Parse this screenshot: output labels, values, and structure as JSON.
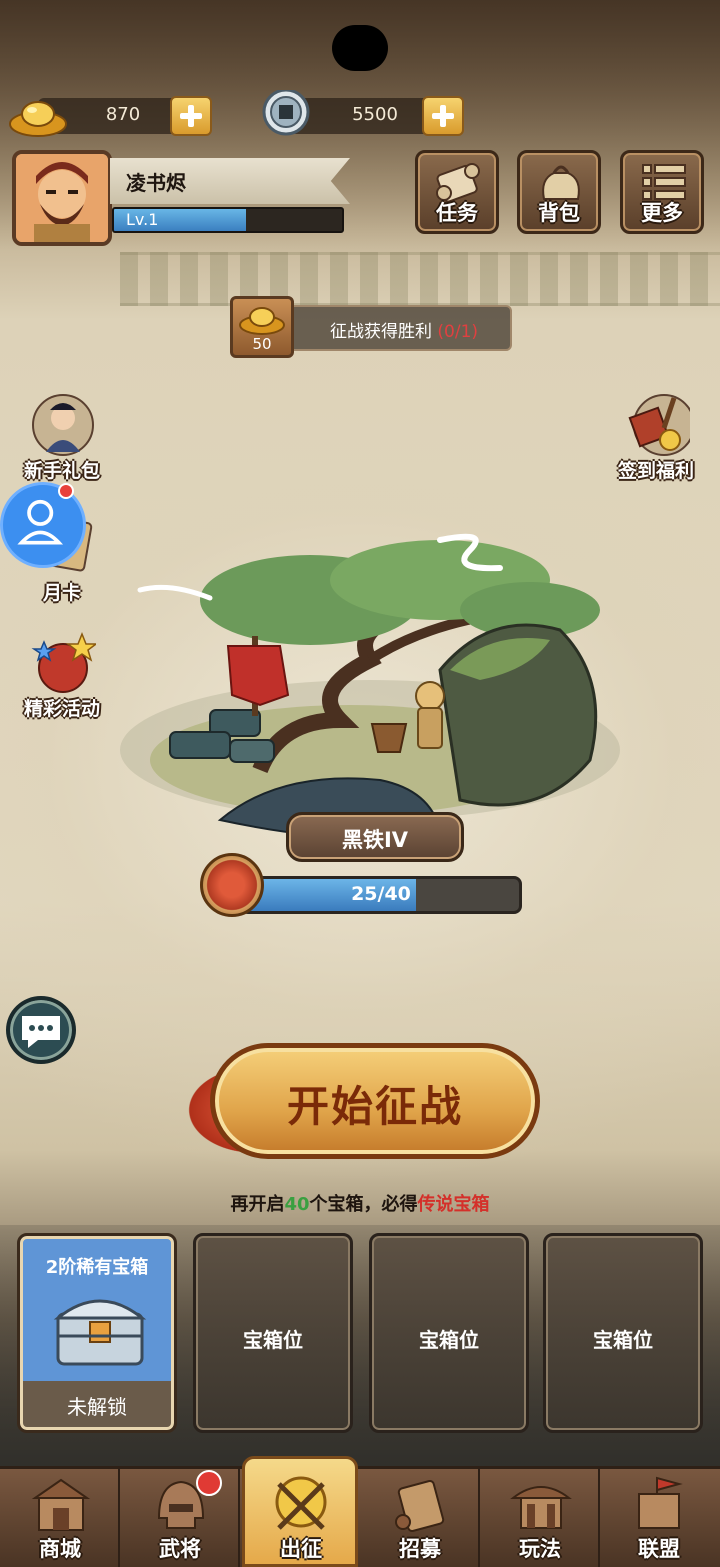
{
  "currencies": {
    "gold": {
      "icon": "gold-ingot-icon",
      "value": "870"
    },
    "coin": {
      "icon": "copper-coin-icon",
      "value": "5500"
    }
  },
  "profile": {
    "name": "凌书烬",
    "level": "Lv.1",
    "xp_fraction": 0.58
  },
  "top_menu": [
    {
      "label": "任务",
      "icon": "scroll-icon"
    },
    {
      "label": "背包",
      "icon": "bag-icon"
    },
    {
      "label": "更多",
      "icon": "list-icon"
    }
  ],
  "quest": {
    "reward_count": "50",
    "text": "征战获得胜利",
    "progress": "(0/1)"
  },
  "side_left": [
    {
      "label": "新手礼包",
      "icon": "hero-gift-icon"
    },
    {
      "label": "月卡",
      "icon": "month-card-icon"
    },
    {
      "label": "精彩活动",
      "icon": "event-bag-icon"
    }
  ],
  "side_right": [
    {
      "label": "签到福利",
      "icon": "checkin-chest-icon"
    }
  ],
  "rank": {
    "name": "黑铁IV",
    "progress_text": "25/40",
    "progress_fraction": 0.625
  },
  "start_button": {
    "label": "开始征战"
  },
  "chest_tip": {
    "prefix": "再开启",
    "count": "40",
    "middle": "个宝箱，必得",
    "reward": "传说宝箱"
  },
  "chest_slots": [
    {
      "title": "2阶稀有宝箱",
      "status": "未解锁"
    },
    {
      "label": "宝箱位"
    },
    {
      "label": "宝箱位"
    },
    {
      "label": "宝箱位"
    }
  ],
  "bottom_nav": [
    {
      "label": "商城",
      "icon": "shop-icon"
    },
    {
      "label": "武将",
      "icon": "general-helmet-icon"
    },
    {
      "label": "出征",
      "icon": "crossed-swords-icon"
    },
    {
      "label": "招募",
      "icon": "recruit-scroll-icon"
    },
    {
      "label": "玩法",
      "icon": "pavilion-icon"
    },
    {
      "label": "联盟",
      "icon": "alliance-flag-icon"
    }
  ],
  "colors": {
    "accent_blue": "#3b7fc0",
    "gold": "#e0a44a",
    "progress_red": "#e04040",
    "tip_green": "#3aa040",
    "tip_red": "#d4302a"
  }
}
